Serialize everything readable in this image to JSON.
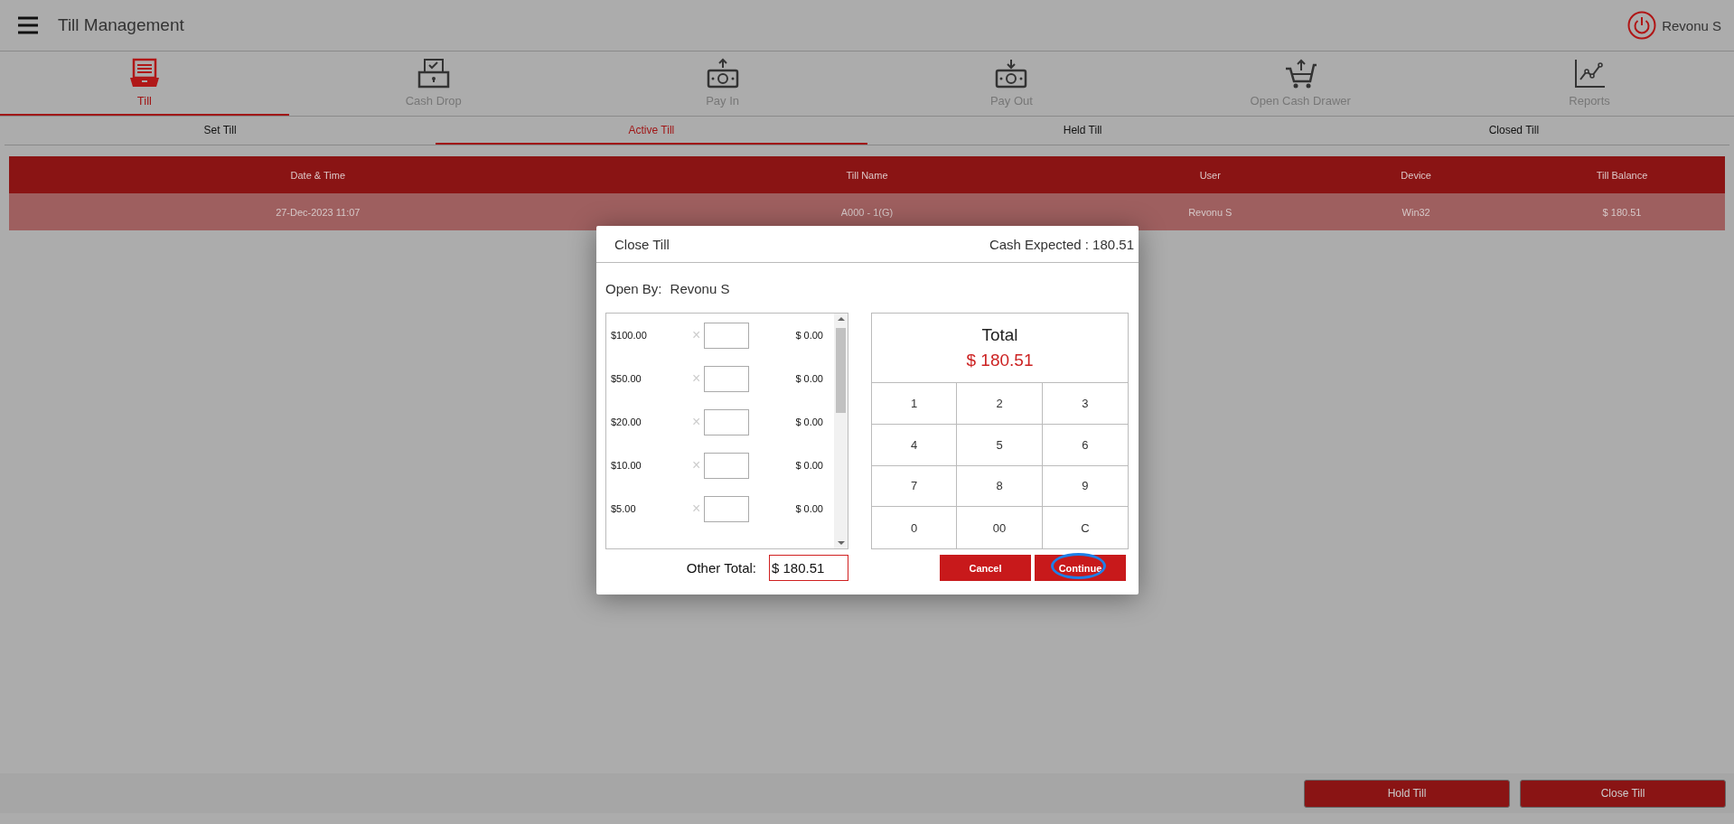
{
  "header": {
    "title": "Till Management",
    "user": "Revonu S"
  },
  "nav_tabs": [
    {
      "label": "Till",
      "kind": "till",
      "selected": true
    },
    {
      "label": "Cash Drop",
      "kind": "drop",
      "selected": false
    },
    {
      "label": "Pay In",
      "kind": "payin",
      "selected": false
    },
    {
      "label": "Pay Out",
      "kind": "payout",
      "selected": false
    },
    {
      "label": "Open Cash Drawer",
      "kind": "cart",
      "selected": false
    },
    {
      "label": "Reports",
      "kind": "chart",
      "selected": false
    }
  ],
  "sub_tabs": [
    {
      "label": "Set Till",
      "selected": false
    },
    {
      "label": "Active Till",
      "selected": true
    },
    {
      "label": "Held Till",
      "selected": false
    },
    {
      "label": "Closed Till",
      "selected": false
    }
  ],
  "table": {
    "columns": [
      "Date & Time",
      "Till Name",
      "User",
      "Device",
      "Till Balance"
    ],
    "rows": [
      [
        "27-Dec-2023 11:07",
        "A000 - 1(G)",
        "Revonu S",
        "Win32",
        "$ 180.51"
      ]
    ]
  },
  "dialog": {
    "title": "Close Till",
    "cash_expected": "Cash Expected : 180.51",
    "open_by_label": "Open By:",
    "open_by_value": "Revonu S",
    "denominations": [
      {
        "label": "$100.00",
        "sign": "×",
        "amount": "$ 0.00"
      },
      {
        "label": "$50.00",
        "sign": "×",
        "amount": "$ 0.00"
      },
      {
        "label": "$20.00",
        "sign": "×",
        "amount": "$ 0.00"
      },
      {
        "label": "$10.00",
        "sign": "×",
        "amount": "$ 0.00"
      },
      {
        "label": "$5.00",
        "sign": "×",
        "amount": "$ 0.00"
      }
    ],
    "other_total_label": "Other Total:",
    "other_total_value": "$ 180.51",
    "total_label": "Total",
    "total_value": "$ 180.51",
    "keypad": [
      "1",
      "2",
      "3",
      "4",
      "5",
      "6",
      "7",
      "8",
      "9",
      "0",
      "00",
      "C"
    ],
    "buttons": [
      {
        "label": "Cancel",
        "focused": false
      },
      {
        "label": "Continue",
        "focused": true
      }
    ]
  },
  "footer_buttons": [
    "Hold Till",
    "Close Till"
  ]
}
